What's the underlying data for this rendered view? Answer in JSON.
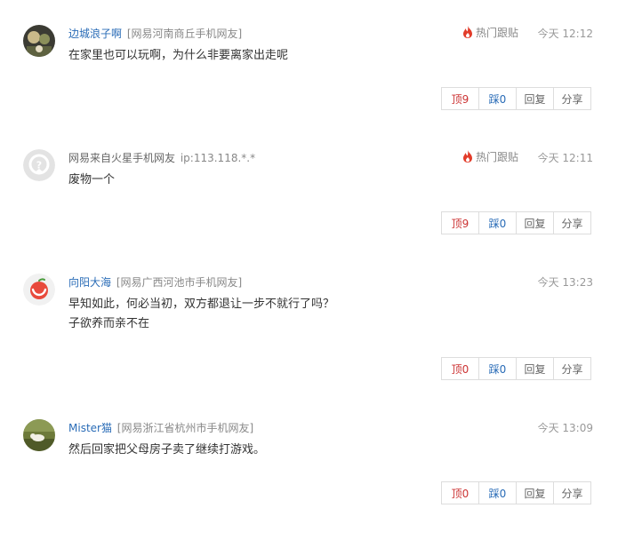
{
  "comments": [
    {
      "user": "边城浪子啊",
      "location": "[网易河南商丘手机网友]",
      "hot_label": "热门跟贴",
      "time": "今天 12:12",
      "lines": [
        "在家里也可以玩啊，为什么非要离家出走呢"
      ],
      "up": "顶9",
      "down": "踩0",
      "reply": "回复",
      "share": "分享"
    },
    {
      "user": "网易来自火星手机网友",
      "location": "ip:113.118.*.*",
      "hot_label": "热门跟贴",
      "time": "今天 12:11",
      "lines": [
        "废物一个"
      ],
      "up": "顶9",
      "down": "踩0",
      "reply": "回复",
      "share": "分享"
    },
    {
      "user": "向阳大海",
      "location": "[网易广西河池市手机网友]",
      "time": "今天 13:23",
      "lines": [
        "早知如此，何必当初，双方都退让一步不就行了吗？",
        "子欲养而亲不在"
      ],
      "up": "顶0",
      "down": "踩0",
      "reply": "回复",
      "share": "分享"
    },
    {
      "user": "Mister猫",
      "location": "[网易浙江省杭州市手机网友]",
      "time": "今天 13:09",
      "lines": [
        "然后回家把父母房子卖了继续打游戏。"
      ],
      "up": "顶0",
      "down": "踩0",
      "reply": "回复",
      "share": "分享"
    }
  ],
  "colors": {
    "username": "#2a6cb7",
    "up_vote": "#cc3333",
    "down_vote": "#2a6cb7",
    "hot_flame": "#e23c2a"
  },
  "icons": {
    "hot": "flame-icon"
  }
}
